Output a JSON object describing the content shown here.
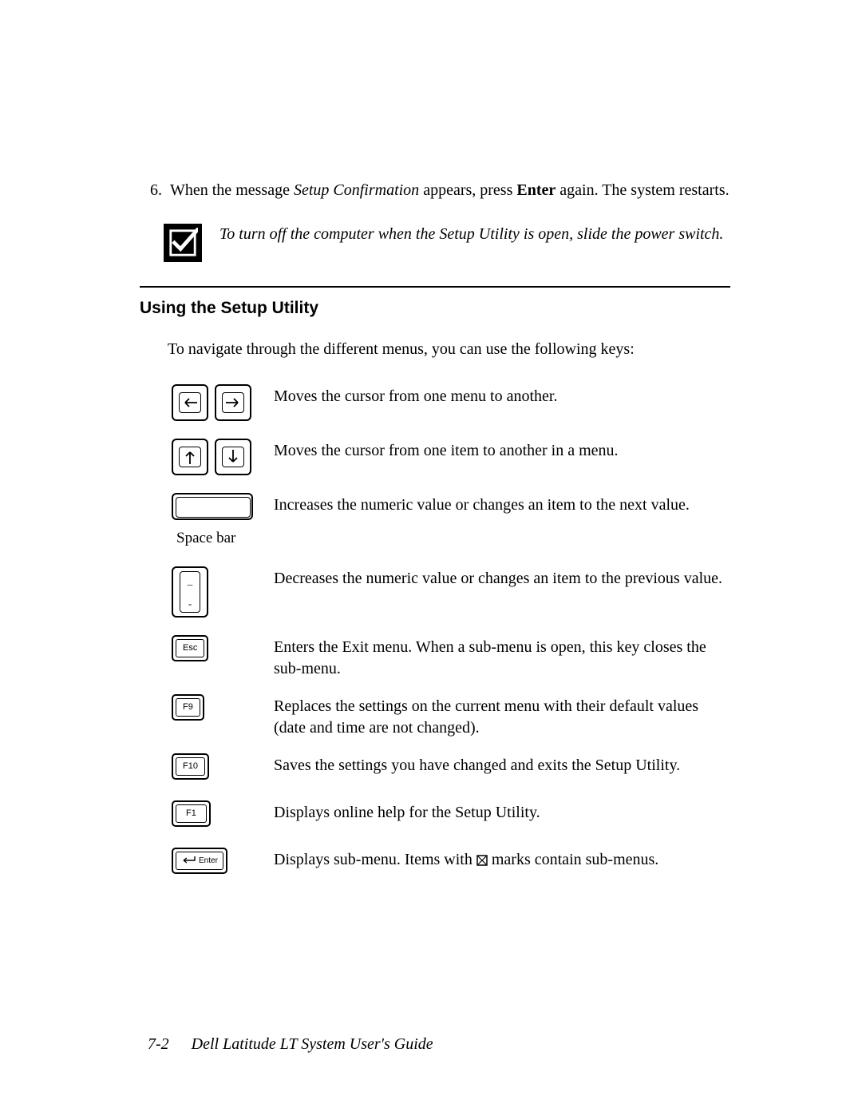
{
  "step6": {
    "number": "6.",
    "text_before_italic": "When the message ",
    "italic": "Setup Confirmation",
    "text_mid": " appears, press ",
    "bold": "Enter",
    "text_after": " again. The system restarts."
  },
  "note": "To turn off the computer when the Setup Utility is open, slide the power switch.",
  "heading": "Using the Setup Utility",
  "intro": "To navigate through the different menus, you can use the following keys:",
  "keys": {
    "leftright": "Moves the cursor from one menu to another.",
    "updown": "Moves the cursor from one item to another in a menu.",
    "spacebar_label": "Space bar",
    "spacebar": "Increases the numeric value or changes an item to the next value.",
    "minus_top": "_",
    "minus_bottom": "-",
    "minus": "Decreases the numeric value or changes an item to the previous value.",
    "esc_label": "Esc",
    "esc": "Enters the Exit menu. When a sub-menu is open, this key closes the sub-menu.",
    "f9_label": "F9",
    "f9": "Replaces the settings on the current menu with their default values (date and time are not changed).",
    "f10_label": "F10",
    "f10": "Saves the settings you have changed and exits the Setup Utility.",
    "f1_label": "F1",
    "f1": "Displays online help for the Setup Utility.",
    "enter_label": "Enter",
    "enter_before": "Displays sub-menu. Items with ",
    "enter_after": " marks contain sub-menus."
  },
  "footer": {
    "page": "7-2",
    "title": "Dell Latitude LT System User's Guide"
  }
}
